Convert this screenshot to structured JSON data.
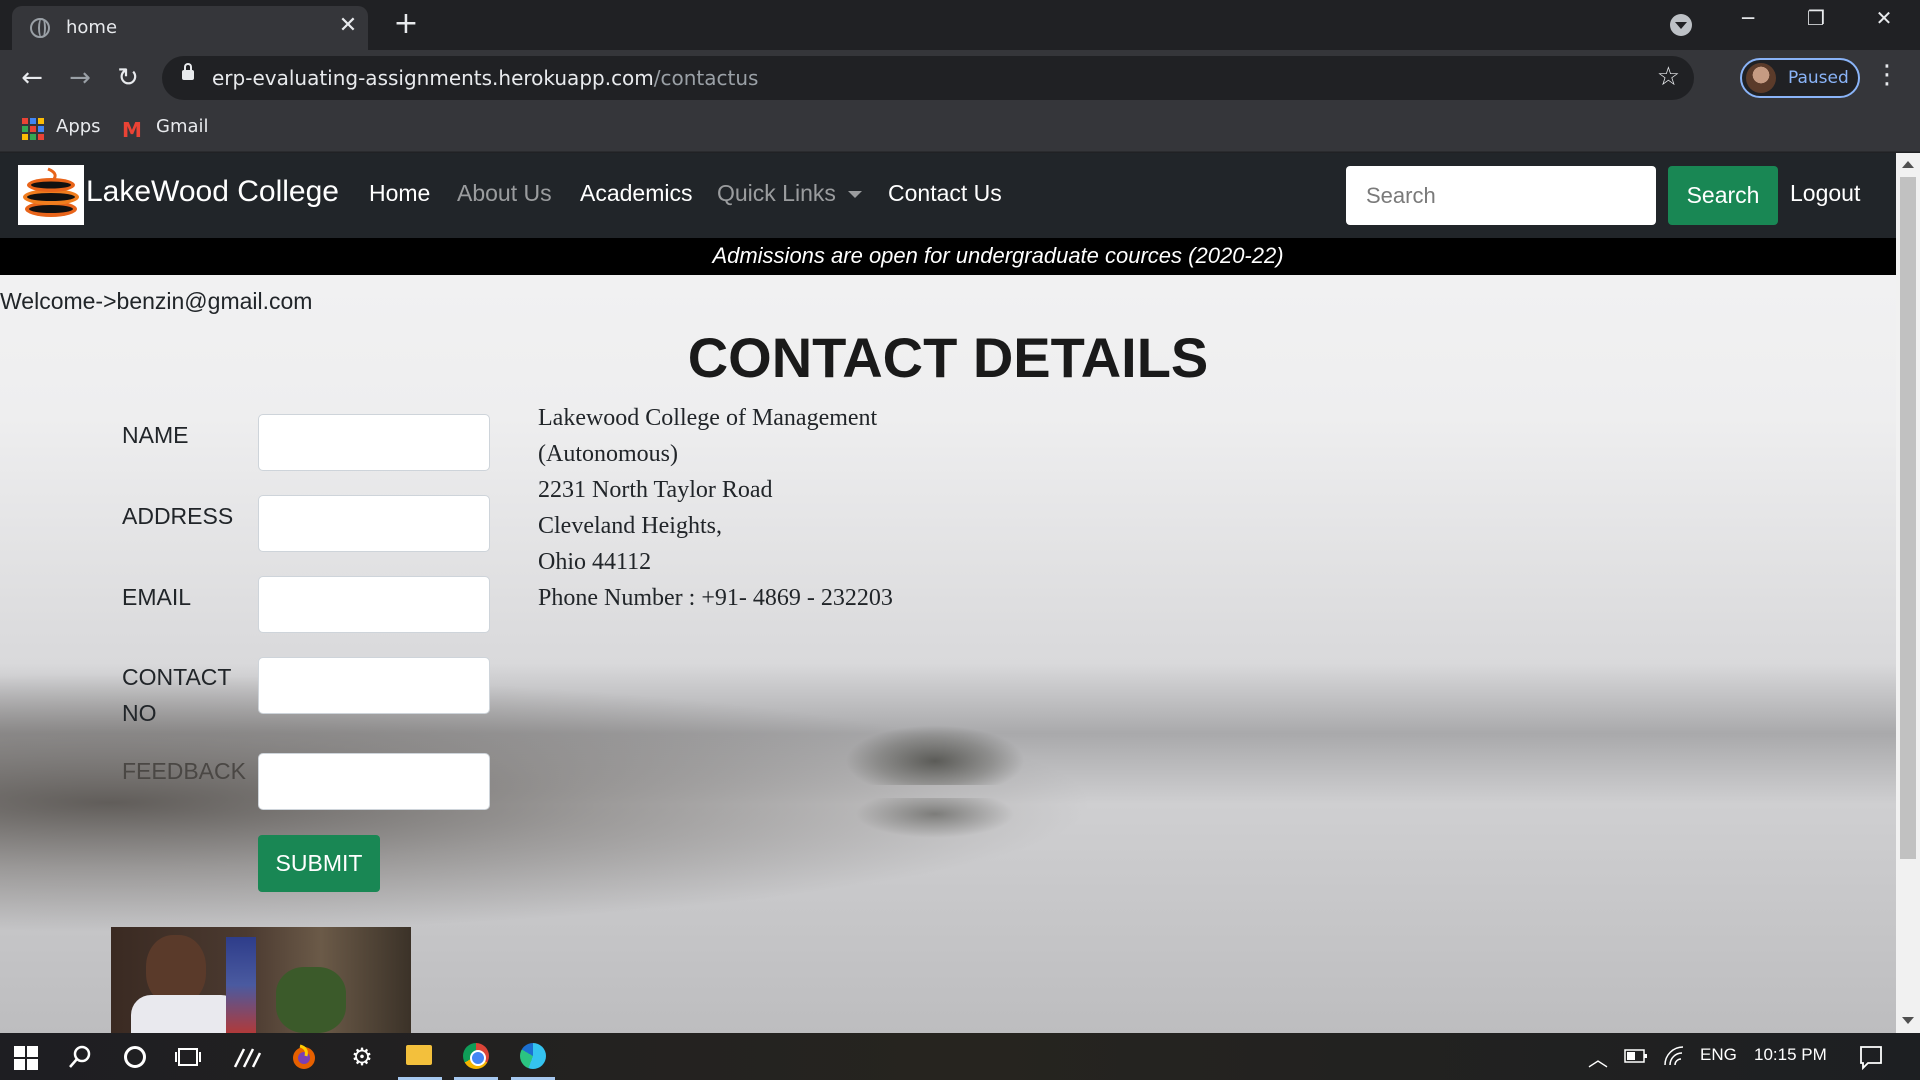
{
  "browser": {
    "tab_title": "home",
    "tab_close": "✕",
    "new_tab": "+",
    "url_host": "erp-evaluating-assignments.herokuapp.com",
    "url_path": "/contactus",
    "profile_status": "Paused",
    "bookmarks": [
      {
        "label": "Apps",
        "icon": "apps-grid-icon"
      },
      {
        "label": "Gmail",
        "icon": "gmail-icon",
        "icon_text": "M"
      }
    ],
    "window_controls": {
      "minimize": "─",
      "restore": "❐",
      "close": "✕"
    },
    "nav_icons": {
      "back": "←",
      "forward": "→",
      "reload": "↻",
      "star": "☆",
      "menu": "⋮"
    }
  },
  "site": {
    "brand": "LakeWood College",
    "nav": [
      {
        "label": "Home",
        "active": true
      },
      {
        "label": "About Us",
        "active": false
      },
      {
        "label": "Academics",
        "active": true
      },
      {
        "label": "Quick Links",
        "active": false,
        "dropdown": true
      },
      {
        "label": "Contact Us",
        "active": true
      }
    ],
    "search_placeholder": "Search",
    "search_button": "Search",
    "logout": "Logout",
    "announcement": "Admissions are open for undergraduate cources (2020-22)",
    "welcome": "Welcome->benzin@gmail.com",
    "heading": "CONTACT DETAILS",
    "form": {
      "fields": [
        {
          "label": "NAME",
          "value": ""
        },
        {
          "label": "ADDRESS",
          "value": ""
        },
        {
          "label": "EMAIL",
          "value": ""
        },
        {
          "label": "CONTACT NO",
          "value": ""
        },
        {
          "label": "FEEDBACK",
          "value": ""
        }
      ],
      "submit": "SUBMIT"
    },
    "address_lines": [
      "Lakewood College of Management (Autonomous)",
      "2231 North Taylor Road",
      "Cleveland Heights,",
      "Ohio 44112",
      "Phone Number : +91- 4869 - 232203"
    ],
    "colors": {
      "nav_bg": "#212529",
      "button_green": "#198754",
      "announcement_bg": "#000000"
    }
  },
  "taskbar": {
    "icons": [
      "windows-start-icon",
      "search-icon",
      "cortana-icon",
      "task-view-icon",
      "pen-icon",
      "firefox-icon",
      "settings-icon",
      "file-explorer-icon",
      "chrome-icon",
      "edge-icon"
    ],
    "language": "ENG",
    "time": "10:15 PM"
  }
}
